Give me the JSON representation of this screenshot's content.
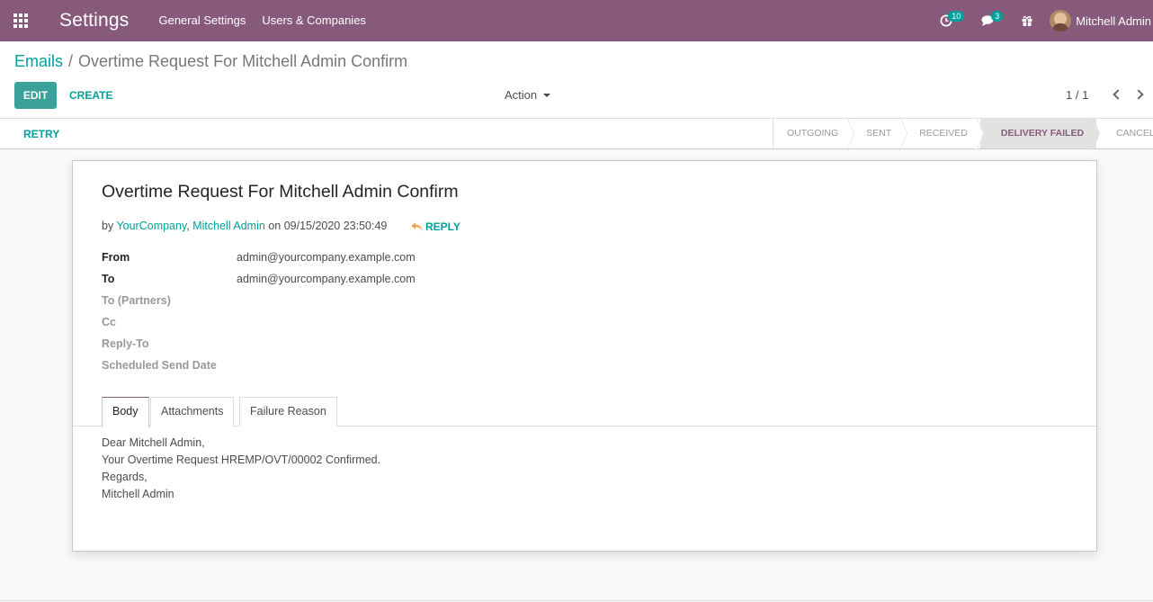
{
  "navbar": {
    "app_title": "Settings",
    "menu": [
      "General Settings",
      "Users & Companies"
    ],
    "activity_count": "10",
    "message_count": "3",
    "user_name": "Mitchell Admin"
  },
  "breadcrumb": {
    "parent": "Emails",
    "separator": "/",
    "current": "Overtime Request For Mitchell Admin Confirm"
  },
  "toolbar": {
    "edit_label": "EDIT",
    "create_label": "CREATE",
    "action_label": "Action",
    "pager": "1 / 1"
  },
  "statusbar": {
    "retry_label": "RETRY",
    "stages": [
      "OUTGOING",
      "SENT",
      "RECEIVED",
      "DELIVERY FAILED",
      "CANCELLED"
    ],
    "active_stage": "DELIVERY FAILED"
  },
  "email": {
    "subject": "Overtime Request For Mitchell Admin Confirm",
    "meta_by": "by",
    "author_company": "YourCompany",
    "author_sep": ", ",
    "author_name": "Mitchell Admin",
    "meta_on": "on 09/15/2020 23:50:49",
    "reply_label": "REPLY",
    "fields": {
      "from_label": "From",
      "from_value": "admin@yourcompany.example.com",
      "to_label": "To",
      "to_value": "admin@yourcompany.example.com",
      "to_partners_label": "To (Partners)",
      "cc_label": "Cc",
      "reply_to_label": "Reply-To",
      "scheduled_label": "Scheduled Send Date"
    },
    "tabs": [
      "Body",
      "Attachments",
      "Failure Reason"
    ],
    "body_lines": [
      "Dear Mitchell Admin,",
      "Your Overtime Request HREMP/OVT/00002 Confirmed.",
      "Regards,",
      "Mitchell Admin"
    ]
  },
  "colors": {
    "brand": "#875a7b",
    "accent": "#00a09d"
  }
}
